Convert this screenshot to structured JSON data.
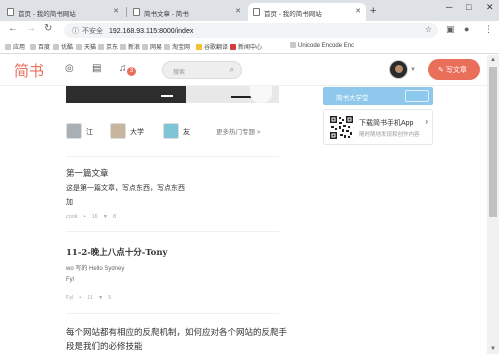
{
  "browser": {
    "tabs": [
      {
        "title": "首页 - 我的简书网站"
      },
      {
        "title": "简书文章 - 简书"
      },
      {
        "title": "首页 - 我的简书网站"
      }
    ],
    "address": {
      "secure_label": "不安全",
      "url": "192.168.93.115:8000/index"
    },
    "bookmarks": [
      "应用",
      "百度",
      "优酷",
      "天猫",
      "京东",
      "新浪",
      "网易",
      "淘宝网",
      "谷歌翻译",
      "新闻中心",
      "Unicode Encode Enc"
    ]
  },
  "site": {
    "logo": "简书",
    "notification_count": "3",
    "search_placeholder": "搜索",
    "write_button": "写文章"
  },
  "authors": [
    {
      "name": "江"
    },
    {
      "name": "大学"
    },
    {
      "name": "友"
    }
  ],
  "more_topics": "更多热门专题 >",
  "sidebar": {
    "banner_label": "简书大学堂",
    "app_title": "下载简书手机App",
    "app_subtitle": "随时随地发现和创作内容"
  },
  "articles": [
    {
      "title": "第一篇文章",
      "abstract_line1": "这是第一篇文章，写点东西，写点东西",
      "abstract_line2": "加",
      "meta": [
        "cook",
        "16",
        "8"
      ]
    },
    {
      "title": "11-2-晚上八点十分-Tony",
      "abstract_line1": "wo 写的 Hello Sydney",
      "abstract_line2": "Fyl",
      "meta": [
        "Fyl",
        "11",
        "5"
      ]
    },
    {
      "title": "每个网站都有相应的反爬机制，如何应对各个网站的反爬手",
      "title_line2": "段是我们的必修技能"
    }
  ]
}
